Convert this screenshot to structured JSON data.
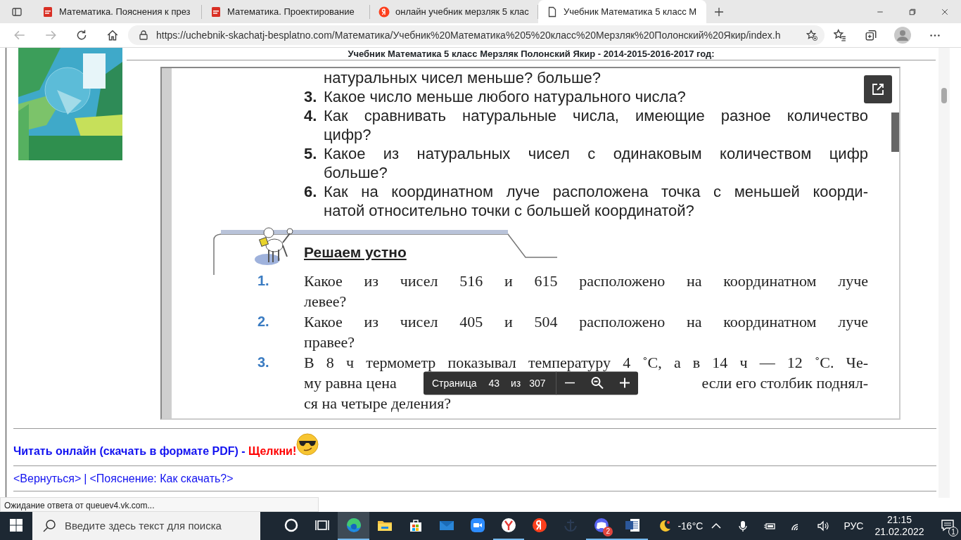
{
  "browser": {
    "tabs": [
      {
        "title": "Математика. Пояснения к през",
        "kind": "pdf",
        "selected": false
      },
      {
        "title": "Математика. Проектирование",
        "kind": "pdf",
        "selected": false
      },
      {
        "title": "онлайн учебник мерзляк 5 клас",
        "kind": "search",
        "selected": false
      },
      {
        "title": "Учебник Математика 5 класс М",
        "kind": "page",
        "selected": true
      }
    ],
    "address": "https://uchebnik-skachatj-besplatno.com/Математика/Учебник%20Математика%205%20класс%20Мерзляк%20Полонский%20Якир/index.h",
    "status_text": "Ожидание ответа от queuev4.vk.com..."
  },
  "page": {
    "header": "Учебник Математика 5 класс Мерзляк Полонский Якир - 2014-2015-2016-2017 год:",
    "pdf_viewer": {
      "top_line": "натуральных чисел меньше? больше?",
      "questions": [
        {
          "number": "3.",
          "lines": [
            [
              "Какое число меньше любого натурального числа?"
            ]
          ]
        },
        {
          "number": "4.",
          "lines": [
            [
              "Как сравнивать натуральные числа, имеющие разное количество"
            ],
            [
              "цифр?"
            ]
          ]
        },
        {
          "number": "5.",
          "lines": [
            [
              "Какое из натуральных чисел с одинаковым количеством цифр"
            ],
            [
              "больше?"
            ]
          ]
        },
        {
          "number": "6.",
          "lines": [
            [
              "Как на координатном луче расположена точка с меньшей коорди-"
            ],
            [
              "натой относительно точки с большей координатой?"
            ]
          ]
        }
      ],
      "section_title": "Решаем устно",
      "exercises": [
        {
          "number": "1.",
          "lines": [
            [
              "Какое из чисел 516 и 615 расположено на координатном луче"
            ],
            [
              "левее?"
            ]
          ]
        },
        {
          "number": "2.",
          "lines": [
            [
              "Какое из чисел 405 и 504 расположено на координатном луче"
            ],
            [
              "правее?"
            ]
          ]
        },
        {
          "number": "3.",
          "lines": [
            [
              "В 8 ч термометр показывал температуру 4 ˚С, а в 14 ч — 12 ˚С. Че-"
            ],
            [
              "му равна цена",
              "если его столбик поднял-"
            ],
            [
              "ся на четыре деления?"
            ]
          ]
        }
      ],
      "toolbar": {
        "page_label": "Страница",
        "page": "43",
        "of": "из",
        "total": "307"
      }
    },
    "read_link": {
      "text": "Читать онлайн (скачать в формате PDF) -",
      "accent": "Щелкни!"
    },
    "nav_links": [
      "<Вернуться>",
      "<Пояснение: Как скачать?>"
    ],
    "nav_separator": "|"
  },
  "taskbar": {
    "search_placeholder": "Введите здесь текст для поиска",
    "apps": [
      {
        "kind": "cortana",
        "active": false,
        "running": false
      },
      {
        "kind": "taskview",
        "active": false,
        "running": false
      },
      {
        "kind": "edge",
        "active": true,
        "running": true
      },
      {
        "kind": "explorer",
        "active": false,
        "running": false
      },
      {
        "kind": "store",
        "active": false,
        "running": false
      },
      {
        "kind": "mail",
        "active": false,
        "running": false
      },
      {
        "kind": "zoom",
        "active": false,
        "running": false
      },
      {
        "kind": "ybrowser",
        "active": false,
        "running": true
      },
      {
        "kind": "yandex",
        "active": false,
        "running": false
      },
      {
        "kind": "anchor",
        "active": false,
        "running": false
      },
      {
        "kind": "discord",
        "active": false,
        "running": true,
        "badge": "2"
      },
      {
        "kind": "word",
        "active": false,
        "running": true
      }
    ],
    "weather": "-16°C",
    "language": "РУС",
    "time": "21:15",
    "date": "21.02.2022",
    "notifications": "1"
  }
}
